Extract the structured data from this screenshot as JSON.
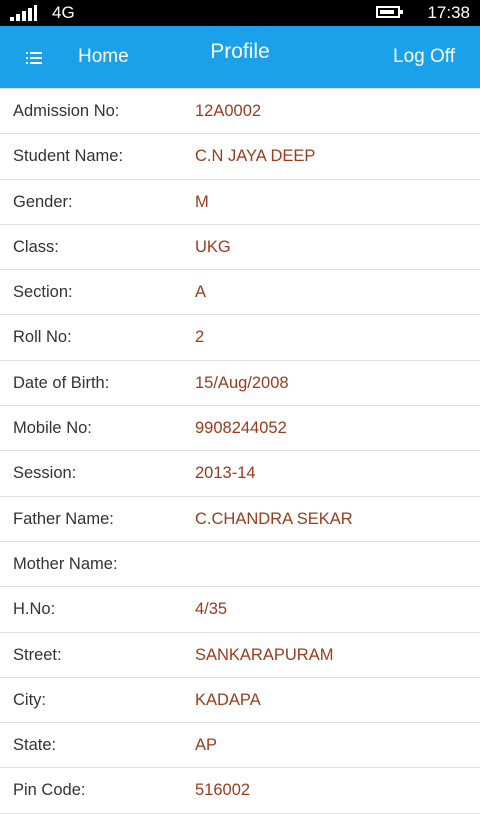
{
  "status_bar": {
    "network": "4G",
    "time": "17:38"
  },
  "header": {
    "home_label": "Home",
    "title": "Profile",
    "logoff_label": "Log Off"
  },
  "profile": {
    "fields": [
      {
        "label": "Admission No:",
        "value": "12A0002"
      },
      {
        "label": "Student Name:",
        "value": "C.N JAYA DEEP"
      },
      {
        "label": "Gender:",
        "value": "M"
      },
      {
        "label": "Class:",
        "value": "UKG"
      },
      {
        "label": "Section:",
        "value": "A"
      },
      {
        "label": "Roll No:",
        "value": "2"
      },
      {
        "label": "Date of Birth:",
        "value": "15/Aug/2008"
      },
      {
        "label": "Mobile No:",
        "value": "9908244052"
      },
      {
        "label": "Session:",
        "value": "2013-14"
      },
      {
        "label": "Father Name:",
        "value": "C.CHANDRA SEKAR"
      },
      {
        "label": "Mother Name:",
        "value": ""
      },
      {
        "label": "H.No:",
        "value": "4/35"
      },
      {
        "label": "Street:",
        "value": "SANKARAPURAM"
      },
      {
        "label": "City:",
        "value": "KADAPA"
      },
      {
        "label": "State:",
        "value": "AP"
      },
      {
        "label": "Pin Code:",
        "value": "516002"
      }
    ]
  },
  "colors": {
    "app_bar": "#1aa1ea",
    "value_text": "#9b3b1e",
    "label_text": "#333333"
  },
  "icons": {
    "menu": "menu-list-icon",
    "signal": "signal-icon",
    "battery": "battery-icon"
  }
}
